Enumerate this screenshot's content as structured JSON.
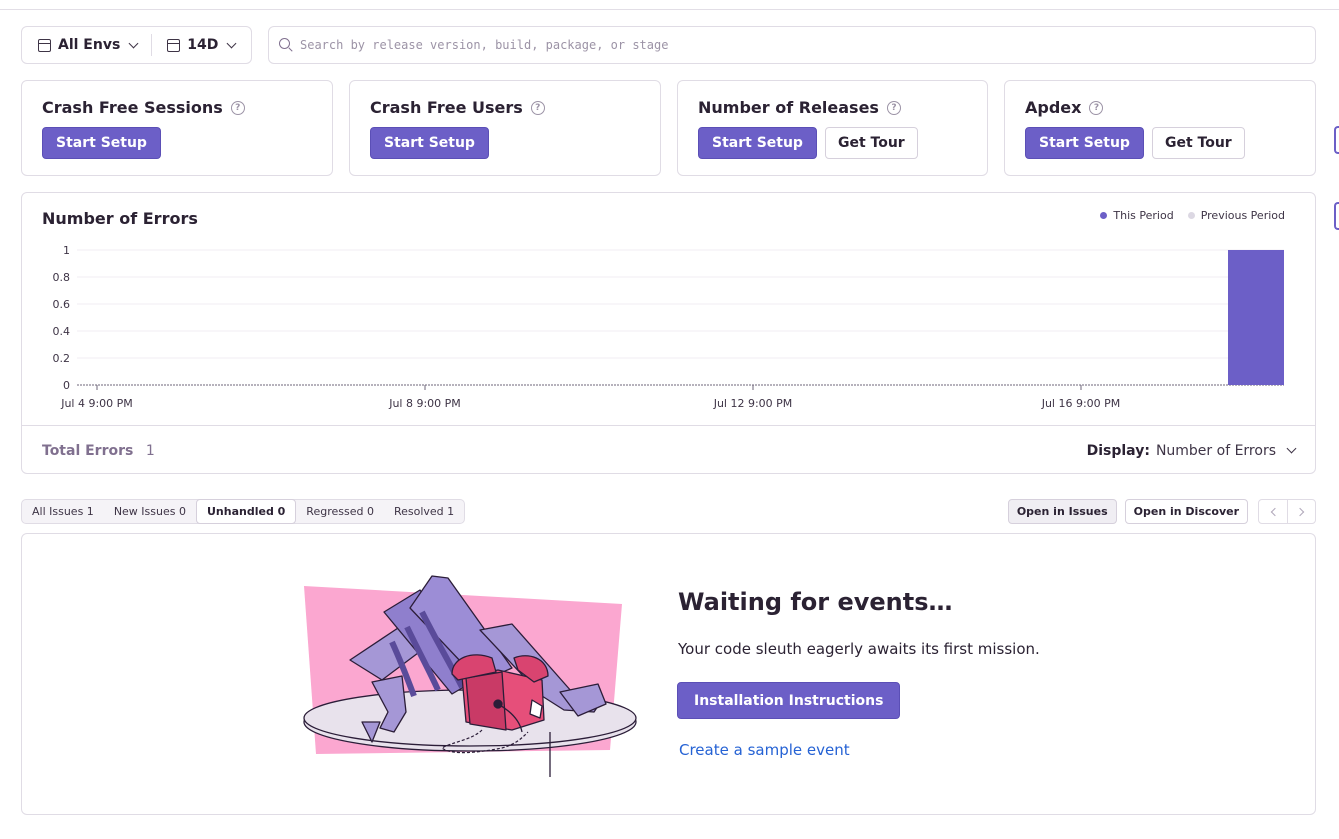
{
  "filters": {
    "environment_label": "All Envs",
    "period_label": "14D",
    "search_placeholder": "Search by release version, build, package, or stage"
  },
  "score_cards": [
    {
      "title": "Crash Free Sessions",
      "primary": "Start Setup"
    },
    {
      "title": "Crash Free Users",
      "primary": "Start Setup"
    },
    {
      "title": "Number of Releases",
      "primary": "Start Setup",
      "secondary": "Get Tour"
    },
    {
      "title": "Apdex",
      "primary": "Start Setup",
      "secondary": "Get Tour"
    }
  ],
  "chart": {
    "title": "Number of Errors",
    "legend_this": "This Period",
    "legend_previous": "Previous Period",
    "total_label": "Total Errors",
    "total_value": "1",
    "display_label": "Display:",
    "display_value": "Number of Errors"
  },
  "chart_data": {
    "type": "bar",
    "title": "Number of Errors",
    "y_ticks": [
      "0",
      "0.2",
      "0.4",
      "0.6",
      "0.8",
      "1"
    ],
    "ylim": [
      0,
      1
    ],
    "x_ticks": [
      "Jul 4 9:00 PM",
      "Jul 8 9:00 PM",
      "Jul 12 9:00 PM",
      "Jul 16 9:00 PM"
    ],
    "series": [
      {
        "name": "This Period",
        "color": "#6c5fc7",
        "values": [
          0,
          0,
          0,
          0,
          0,
          0,
          0,
          0,
          0,
          0,
          0,
          0,
          0,
          0,
          0,
          0,
          0,
          0,
          0,
          0,
          0,
          0,
          0,
          0,
          0,
          0,
          0,
          0,
          0,
          0,
          0,
          0,
          0,
          0,
          0,
          0,
          0,
          0,
          0,
          0,
          0,
          0,
          0,
          0,
          0,
          0,
          0,
          0,
          0,
          0,
          0,
          0,
          0,
          0,
          0,
          0,
          0,
          0,
          0,
          0,
          0,
          0,
          0,
          0,
          0,
          0,
          0,
          0,
          0,
          0,
          0,
          0,
          0,
          0,
          0,
          0,
          0,
          0,
          0,
          0,
          0,
          0,
          0,
          0,
          0,
          0,
          0,
          0,
          0,
          0,
          0,
          0,
          0,
          0,
          0,
          0,
          0,
          0,
          0,
          0,
          0,
          0,
          0,
          0,
          0,
          0,
          0,
          0,
          0,
          0,
          0,
          0,
          0,
          0,
          0,
          0,
          0,
          0,
          0,
          0,
          0,
          0,
          0,
          0,
          0,
          0,
          0,
          0,
          0,
          0,
          0,
          0,
          0,
          0,
          0,
          0,
          0,
          0,
          0,
          0,
          0,
          0,
          0,
          0,
          0,
          0,
          0,
          0,
          0,
          0,
          0,
          0,
          0,
          0,
          0,
          0,
          0,
          0,
          0,
          0,
          0,
          0,
          0,
          0,
          0,
          0,
          0,
          0,
          1
        ]
      },
      {
        "name": "Previous Period",
        "color": "#dcd8e3",
        "values": []
      }
    ],
    "grid": true,
    "legend_position": "top-right"
  },
  "issues": {
    "tabs": [
      {
        "label": "All Issues 1"
      },
      {
        "label": "New Issues 0"
      },
      {
        "label": "Unhandled 0",
        "active": true
      },
      {
        "label": "Regressed 0"
      },
      {
        "label": "Resolved 1"
      }
    ],
    "open_in_issues": "Open in Issues",
    "open_in_discover": "Open in Discover"
  },
  "empty_state": {
    "title": "Waiting for events…",
    "description": "Your code sleuth eagerly awaits its first mission.",
    "install_button": "Installation Instructions",
    "sample_link": "Create a sample event"
  },
  "colors": {
    "accent": "#6c5fc7",
    "link": "#2562d4",
    "border": "#e0dce5"
  }
}
